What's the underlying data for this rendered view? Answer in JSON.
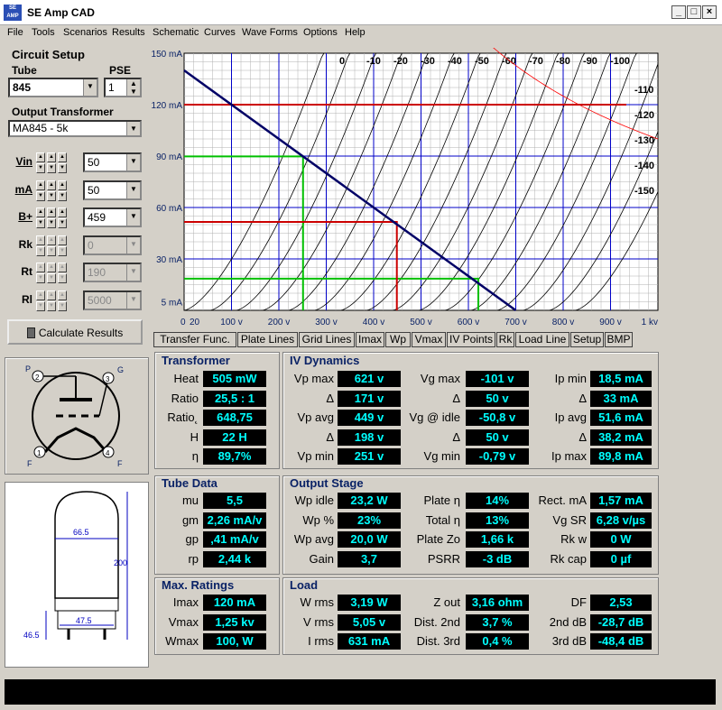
{
  "window": {
    "title": "SE Amp CAD",
    "icon": "app-logo-icon"
  },
  "menu": [
    "File",
    "Tools",
    "Scenarios",
    "Results",
    "Schematic",
    "Curves",
    "Wave Forms",
    "Options",
    "Help"
  ],
  "setup": {
    "heading": "Circuit Setup",
    "tube_label": "Tube",
    "tube_value": "845",
    "pse_label": "PSE",
    "pse_value": "1",
    "ot_label": "Output Transformer",
    "ot_value": "MA845 - 5k",
    "rows": [
      {
        "label": "Vin",
        "value": "50",
        "enabled": true
      },
      {
        "label": "mA",
        "value": "50",
        "enabled": true
      },
      {
        "label": "B+",
        "value": "459",
        "enabled": true
      },
      {
        "label": "Rk",
        "value": "0",
        "enabled": false
      },
      {
        "label": "Rt",
        "value": "190",
        "enabled": false
      },
      {
        "label": "Rl",
        "value": "5000",
        "enabled": false
      }
    ],
    "calc_label": "Calculate Results"
  },
  "chart_data": {
    "type": "line",
    "title": "",
    "y_ticks": [
      "150 mA",
      "120 mA",
      "90 mA",
      "60 mA",
      "30 mA",
      "5 mA"
    ],
    "x_ticks": [
      "0",
      "20",
      "100 v",
      "200 v",
      "300 v",
      "400 v",
      "500 v",
      "600 v",
      "700 v",
      "800 v",
      "900 v",
      "1 kv"
    ],
    "xlim": [
      0,
      1000
    ],
    "ylim": [
      0,
      150
    ],
    "grid_curve_labels": [
      "0",
      "-10",
      "-20",
      "-30",
      "-40",
      "-50",
      "-60",
      "-70",
      "-80",
      "-90",
      "-100",
      "-110",
      "-120",
      "-130",
      "-140",
      "-150"
    ],
    "grid_voltages": [
      0,
      -10,
      -20,
      -30,
      -40,
      -50,
      -60,
      -70,
      -80,
      -90,
      -100,
      -110,
      -120,
      -130,
      -140,
      -150
    ],
    "load_line": {
      "x": [
        0,
        700
      ],
      "y": [
        140,
        0
      ]
    },
    "red_marker": {
      "x": 449,
      "y": 51.6
    },
    "green_marker_high": {
      "x": 251,
      "y": 89.8
    },
    "green_marker_low": {
      "x": 621,
      "y": 18.5
    },
    "max_current": 120,
    "max_dissipation_w": 100,
    "colors": {
      "grid_major": "#0000c8",
      "grid_minor": "#b0b0b0",
      "curve": "#000000",
      "load": "#000066",
      "op": "#cc0000",
      "swing": "#00c000",
      "wmax": "#ff0000"
    }
  },
  "tabs": [
    "Transfer Func.",
    "Plate Lines",
    "Grid Lines",
    "Imax",
    "Wp",
    "Vmax",
    "IV Points",
    "Rk",
    "Load Line",
    "Setup",
    "BMP"
  ],
  "schematic": {
    "pins": [
      "P",
      "G",
      "F",
      "F"
    ],
    "pin_numbers": [
      "2",
      "3",
      "1",
      "4"
    ]
  },
  "tube_dims": {
    "width_top": "66.5",
    "height": "200",
    "base_width": "47.5",
    "base_height": "46.5"
  },
  "transformer": {
    "title": "Transformer",
    "rows": [
      {
        "label": "Heat",
        "value": "505 mW"
      },
      {
        "label": "Ratio",
        "value": "25,5 : 1"
      },
      {
        "label": "Ratio˛",
        "value": "648,75"
      },
      {
        "label": "H",
        "value": "22 H"
      },
      {
        "label": "η",
        "value": "89,7%"
      }
    ]
  },
  "iv": {
    "title": "IV Dynamics",
    "rows": [
      [
        "Vp max",
        "621 v",
        "Vg max",
        "-101 v",
        "Ip min",
        "18,5 mA"
      ],
      [
        "Δ",
        "171 v",
        "Δ",
        "50 v",
        "Δ",
        "33 mA"
      ],
      [
        "Vp avg",
        "449 v",
        "Vg @ idle",
        "-50,8 v",
        "Ip avg",
        "51,6 mA"
      ],
      [
        "Δ",
        "198 v",
        "Δ",
        "50 v",
        "Δ",
        "38,2 mA"
      ],
      [
        "Vp min",
        "251 v",
        "Vg min",
        "-0,79 v",
        "Ip max",
        "89,8 mA"
      ]
    ]
  },
  "tubedata": {
    "title": "Tube Data",
    "rows": [
      {
        "label": "mu",
        "value": "5,5"
      },
      {
        "label": "gm",
        "value": "2,26 mA/v"
      },
      {
        "label": "gp",
        "value": ",41 mA/v"
      },
      {
        "label": "rp",
        "value": "2,44 k"
      }
    ]
  },
  "output": {
    "title": "Output Stage",
    "rows": [
      [
        "Wp idle",
        "23,2 W",
        "Plate η",
        "14%",
        "Rect. mA",
        "1,57 mA"
      ],
      [
        "Wp %",
        "23%",
        "Total η",
        "13%",
        "Vg SR",
        "6,28 v/µs"
      ],
      [
        "Wp avg",
        "20,0 W",
        "Plate Zo",
        "1,66 k",
        "Rk w",
        "0 W"
      ],
      [
        "Gain",
        "3,7",
        "PSRR",
        "-3 dB",
        "Rk cap",
        "0 µf"
      ]
    ]
  },
  "maxratings": {
    "title": "Max. Ratings",
    "rows": [
      {
        "label": "Imax",
        "value": "120 mA"
      },
      {
        "label": "Vmax",
        "value": "1,25 kv"
      },
      {
        "label": "Wmax",
        "value": "100, W"
      }
    ]
  },
  "load": {
    "title": "Load",
    "rows": [
      [
        "W rms",
        "3,19 W",
        "Z out",
        "3,16 ohm",
        "DF",
        "2,53"
      ],
      [
        "V rms",
        "5,05 v",
        "Dist. 2nd",
        "3,7 %",
        "2nd dB",
        "-28,7 dB"
      ],
      [
        "I rms",
        "631 mA",
        "Dist. 3rd",
        "0,4 %",
        "3rd dB",
        "-48,4 dB"
      ]
    ]
  }
}
